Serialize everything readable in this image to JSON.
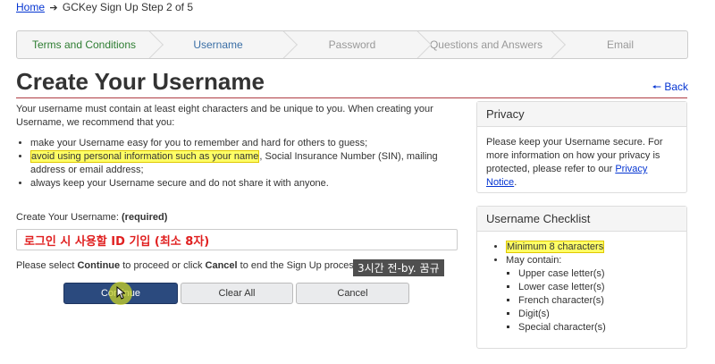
{
  "breadcrumb": {
    "home": "Home",
    "current": "GCKey Sign Up Step 2 of 5"
  },
  "steps": [
    {
      "label": "Terms and Conditions",
      "state": "completed"
    },
    {
      "label": "Username",
      "state": "active"
    },
    {
      "label": "Password",
      "state": "upcoming"
    },
    {
      "label": "Questions and Answers",
      "state": "upcoming"
    },
    {
      "label": "Email",
      "state": "upcoming"
    }
  ],
  "page": {
    "title": "Create Your Username",
    "back": "Back"
  },
  "intro": "Your username must contain at least eight characters and be unique to you. When creating your Username, we recommend that you:",
  "tips": {
    "item1": "make your Username easy for you to remember and hard for others to guess;",
    "item2_highlight": "avoid using personal information such as your name",
    "item2_rest": ", Social Insurance Number (SIN), mailing address or email address;",
    "item3": "always keep your Username secure and do not share it with anyone."
  },
  "form": {
    "label": "Create Your Username:",
    "required": "(required)",
    "value": "로그인 시 사용할 ID 기입 (최소 8자)"
  },
  "instructions": {
    "pre": "Please select ",
    "continue": "Continue",
    "mid": " to proceed or click ",
    "cancel": "Cancel",
    "post": " to end the Sign Up process."
  },
  "buttons": {
    "continue": "Continue",
    "clear": "Clear All",
    "cancel": "Cancel"
  },
  "overlay_note": "3시간 전-by. 꿈규",
  "privacy": {
    "title": "Privacy",
    "text": "Please keep your Username secure. For more information on how your privacy is protected, please refer to our ",
    "link": "Privacy Notice",
    "end": "."
  },
  "checklist": {
    "title": "Username Checklist",
    "item1": "Minimum 8 characters",
    "item2": "May contain:",
    "sub": [
      "Upper case letter(s)",
      "Lower case letter(s)",
      "French character(s)",
      "Digit(s)",
      "Special character(s)"
    ]
  },
  "colors": {
    "accent_rule": "#af3c43",
    "primary_button": "#2b4a7e",
    "link": "#0535d2",
    "highlight": "#ffff66",
    "input_text": "#e02020"
  }
}
